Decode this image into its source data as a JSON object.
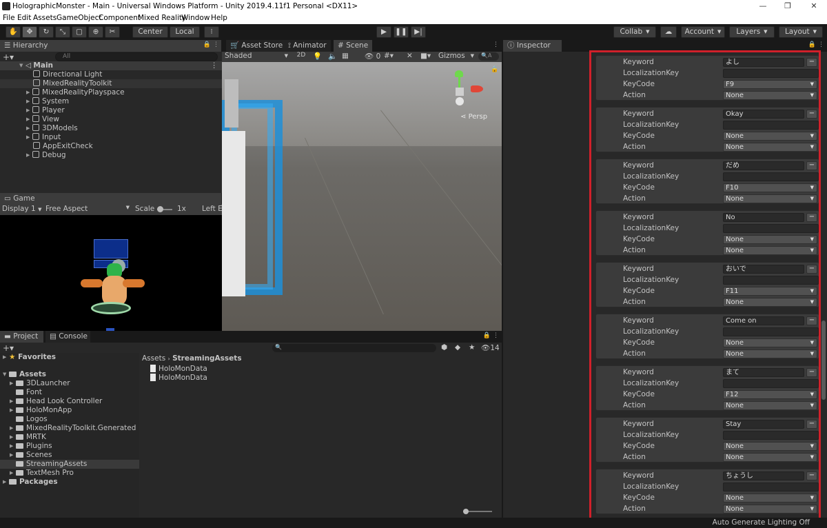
{
  "window": {
    "title": "HolographicMonster - Main - Universal Windows Platform - Unity 2019.4.11f1 Personal <DX11>",
    "controls": {
      "minimize": "—",
      "maximize": "❐",
      "close": "✕"
    }
  },
  "menu": [
    "File",
    "Edit",
    "Assets",
    "GameObject",
    "Component",
    "Mixed Reality",
    "Window",
    "Help"
  ],
  "toolbar": {
    "pivot": "Center",
    "space": "Local",
    "collab": "Collab",
    "account": "Account",
    "layers": "Layers",
    "layout": "Layout"
  },
  "hierarchy": {
    "tab": "Hierarchy",
    "search_placeholder": "All",
    "scene": "Main",
    "items": [
      "Directional Light",
      "MixedRealityToolkit",
      "MixedRealityPlayspace",
      "System",
      "Player",
      "View",
      "3DModels",
      "Input",
      "AppExitCheck",
      "Debug"
    ]
  },
  "scene_tabs": {
    "asset_store": "Asset Store",
    "animator": "Animator",
    "scene": "Scene"
  },
  "scene_toolbar": {
    "shading": "Shaded",
    "mode2d": "2D",
    "hidden_count": "0",
    "gizmos": "Gizmos",
    "search": "A",
    "persp": "Persp"
  },
  "game": {
    "tab": "Game",
    "display": "Display 1",
    "aspect": "Free Aspect",
    "scale_label": "Scale",
    "scale_value": "1x",
    "left_eye": "Left Ey"
  },
  "project": {
    "tab_project": "Project",
    "tab_console": "Console",
    "hidden_count": "14",
    "favorites": "Favorites",
    "assets": "Assets",
    "packages": "Packages",
    "folders": [
      "3DLauncher",
      "Font",
      "Head Look Controller",
      "HoloMonApp",
      "Logos",
      "MixedRealityToolkit.Generated",
      "MRTK",
      "Plugins",
      "Scenes",
      "StreamingAssets",
      "TextMesh Pro"
    ],
    "breadcrumb_root": "Assets",
    "breadcrumb_current": "StreamingAssets",
    "files": [
      "HoloMonData",
      "HoloMonData"
    ]
  },
  "inspector": {
    "tab": "Inspector",
    "labels": {
      "keyword": "Keyword",
      "localization": "LocalizationKey",
      "keycode": "KeyCode",
      "action": "Action"
    },
    "entries": [
      {
        "keyword": "よし",
        "keycode": "F9",
        "action": "None"
      },
      {
        "keyword": "Okay",
        "keycode": "None",
        "action": "None"
      },
      {
        "keyword": "だめ",
        "keycode": "F10",
        "action": "None"
      },
      {
        "keyword": "No",
        "keycode": "None",
        "action": "None"
      },
      {
        "keyword": "おいで",
        "keycode": "F11",
        "action": "None"
      },
      {
        "keyword": "Come on",
        "keycode": "None",
        "action": "None"
      },
      {
        "keyword": "まて",
        "keycode": "F12",
        "action": "None"
      },
      {
        "keyword": "Stay",
        "keycode": "None",
        "action": "None"
      },
      {
        "keyword": "ちょうし",
        "keycode": "None",
        "action": "None"
      }
    ],
    "minus": "−"
  },
  "statusbar": {
    "text": "Auto Generate Lighting Off"
  },
  "colors": {
    "highlight": "#d0202a",
    "panel": "#282828",
    "background": "#191919"
  }
}
